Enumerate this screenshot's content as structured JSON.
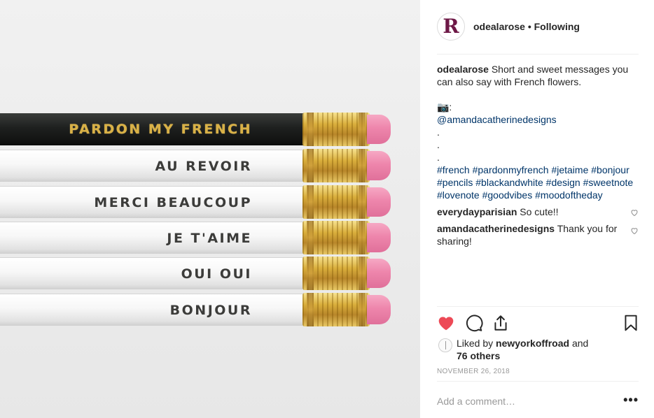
{
  "photo": {
    "pencils": [
      {
        "label": "PARDON MY FRENCH",
        "style": "black"
      },
      {
        "label": "AU REVOIR",
        "style": "white"
      },
      {
        "label": "MERCI BEAUCOUP",
        "style": "white"
      },
      {
        "label": "JE T'AIME",
        "style": "white"
      },
      {
        "label": "OUI OUI",
        "style": "white"
      },
      {
        "label": "BONJOUR",
        "style": "white"
      }
    ]
  },
  "header": {
    "avatar_letter": "R",
    "username": "odealarose",
    "separator": " • ",
    "follow_status": "Following"
  },
  "caption": {
    "user": "odealarose",
    "text": " Short and sweet messages you can also say with French flowers.",
    "camera_line": "📷:",
    "credit": "@amandacatherinedesigns",
    "dots": [
      ".",
      ".",
      "."
    ],
    "hashtags": [
      "#french",
      "#pardonmyfrench",
      "#jetaime",
      "#bonjour",
      "#pencils",
      "#blackandwhite",
      "#design",
      "#sweetnote",
      "#lovenote",
      "#goodvibes",
      "#moodoftheday"
    ]
  },
  "comments": [
    {
      "user": "everydayparisian",
      "text": " So cute!!"
    },
    {
      "user": "amandacatherinedesigns",
      "text": " Thank you for sharing!"
    }
  ],
  "likes": {
    "prefix": "Liked by ",
    "user": "newyorkoffroad",
    "mid": " and",
    "others": "76 others"
  },
  "date": "NOVEMBER 26, 2018",
  "add_comment": {
    "placeholder": "Add a comment…"
  },
  "more_label": "•••",
  "colors": {
    "like_red": "#ed4956",
    "link": "#003569",
    "text": "#262626",
    "muted": "#999999"
  }
}
